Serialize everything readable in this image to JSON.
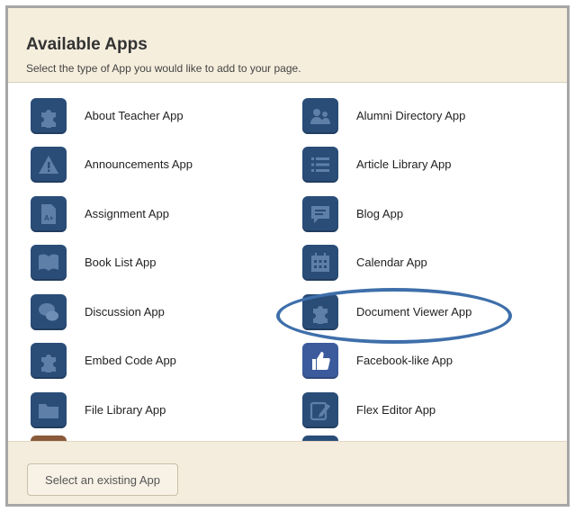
{
  "header": {
    "title": "Available Apps",
    "subtitle": "Select the type of App you would like to add to your page."
  },
  "apps": [
    {
      "label": "About Teacher App",
      "icon": "puzzle-icon"
    },
    {
      "label": "Alumni Directory App",
      "icon": "people-icon"
    },
    {
      "label": "Announcements App",
      "icon": "warning-icon"
    },
    {
      "label": "Article Library App",
      "icon": "list-icon"
    },
    {
      "label": "Assignment App",
      "icon": "grade-document-icon"
    },
    {
      "label": "Blog App",
      "icon": "speech-bubble-icon"
    },
    {
      "label": "Book List App",
      "icon": "book-icon"
    },
    {
      "label": "Calendar App",
      "icon": "calendar-icon"
    },
    {
      "label": "Discussion App",
      "icon": "chat-bubbles-icon"
    },
    {
      "label": "Document Viewer App",
      "icon": "puzzle-icon"
    },
    {
      "label": "Embed Code App",
      "icon": "puzzle-icon"
    },
    {
      "label": "Facebook-like App",
      "icon": "thumbs-up-icon"
    },
    {
      "label": "File Library App",
      "icon": "folder-icon"
    },
    {
      "label": "Flex Editor App",
      "icon": "edit-icon"
    }
  ],
  "footer": {
    "button_label": "Select an existing App"
  },
  "colors": {
    "icon_bg": "#2a4d78",
    "highlight_oval": "#3e6faa",
    "panel_bg": "#f4ecdc"
  }
}
